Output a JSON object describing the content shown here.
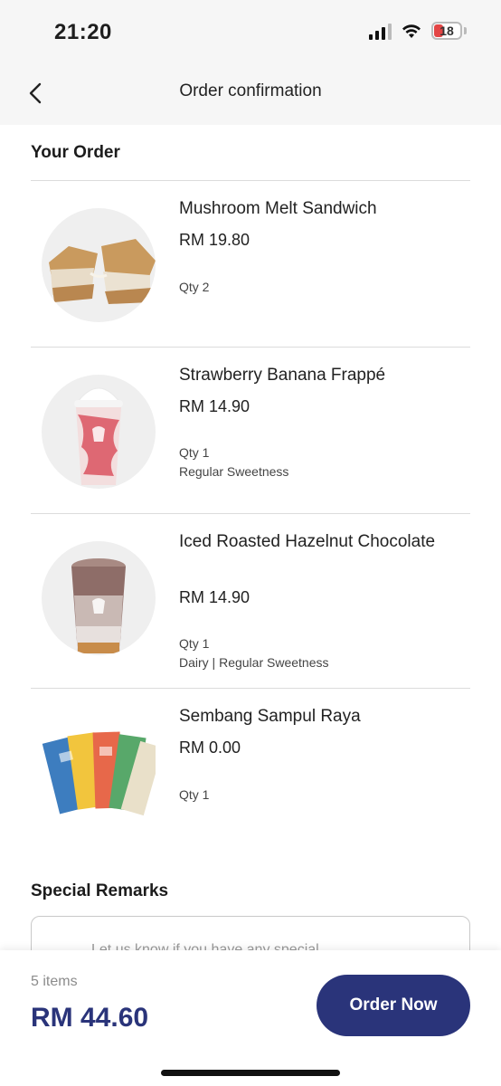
{
  "status_bar": {
    "time": "21:20",
    "battery": "18"
  },
  "header": {
    "title": "Order confirmation"
  },
  "your_order": {
    "title": "Your Order"
  },
  "items": [
    {
      "name": "Mushroom Melt Sandwich",
      "price": "RM 19.80",
      "qty": "Qty 2",
      "options": ""
    },
    {
      "name": "Strawberry Banana Frappé",
      "price": "RM 14.90",
      "qty": "Qty 1",
      "options": "Regular Sweetness"
    },
    {
      "name": "Iced Roasted Hazelnut Chocolate",
      "price": "RM 14.90",
      "qty": "Qty 1",
      "options": "Dairy | Regular Sweetness"
    },
    {
      "name": "Sembang Sampul Raya",
      "price": "RM 0.00",
      "qty": "Qty 1",
      "options": ""
    }
  ],
  "special_remarks": {
    "title": "Special Remarks",
    "placeholder": "Let us know if you have any special"
  },
  "footer": {
    "items_count": "5 items",
    "total": "RM 44.60",
    "order_button": "Order Now"
  },
  "colors": {
    "brand": "#2a347a",
    "header_bg": "#f6f6f6"
  }
}
